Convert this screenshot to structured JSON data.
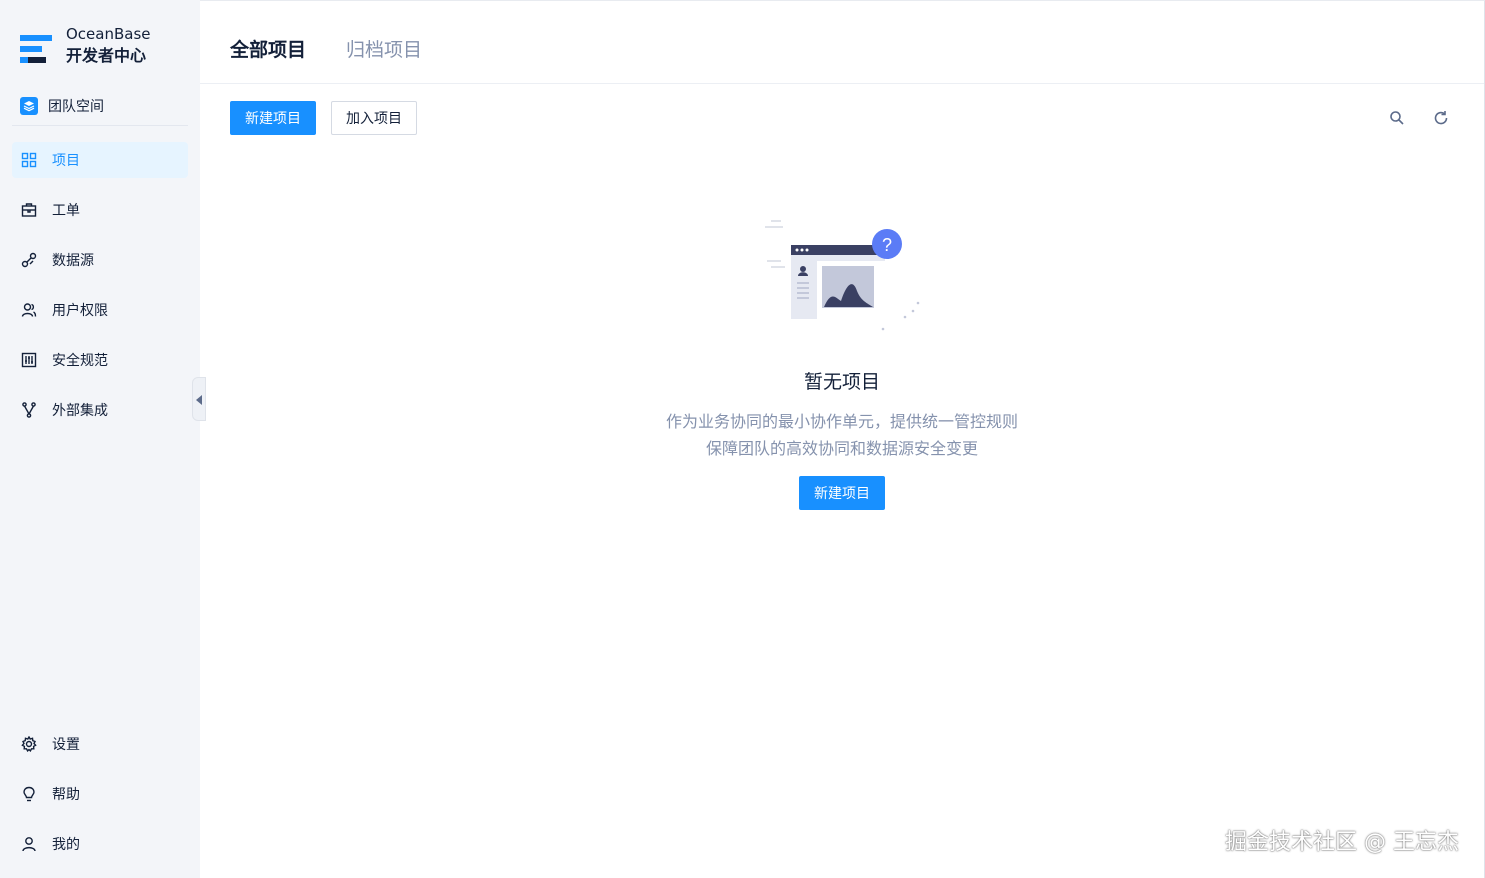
{
  "brand": {
    "name": "OceanBase",
    "subtitle": "开发者中心",
    "colors": {
      "primary": "#1890ff",
      "dark": "#132039"
    }
  },
  "team": {
    "label": "团队空间",
    "icon": "layers-icon"
  },
  "nav": {
    "items": [
      {
        "label": "项目",
        "icon": "grid-icon",
        "active": true
      },
      {
        "label": "工单",
        "icon": "briefcase-icon",
        "active": false
      },
      {
        "label": "数据源",
        "icon": "link-icon",
        "active": false
      },
      {
        "label": "用户权限",
        "icon": "users-icon",
        "active": false
      },
      {
        "label": "安全规范",
        "icon": "sliders-icon",
        "active": false
      },
      {
        "label": "外部集成",
        "icon": "fork-icon",
        "active": false
      }
    ],
    "bottom": [
      {
        "label": "设置",
        "icon": "gear-icon"
      },
      {
        "label": "帮助",
        "icon": "bulb-icon"
      },
      {
        "label": "我的",
        "icon": "user-icon"
      }
    ]
  },
  "tabs": [
    {
      "label": "全部项目",
      "active": true
    },
    {
      "label": "归档项目",
      "active": false
    }
  ],
  "toolbar": {
    "create_label": "新建项目",
    "join_label": "加入项目",
    "search_icon": "search-icon",
    "refresh_icon": "refresh-icon"
  },
  "empty": {
    "title": "暂无项目",
    "desc_line1": "作为业务协同的最小协作单元，提供统一管控规则",
    "desc_line2": "保障团队的高效协同和数据源安全变更",
    "button_label": "新建项目"
  },
  "watermark": "掘金技术社区 @ 王忘杰"
}
